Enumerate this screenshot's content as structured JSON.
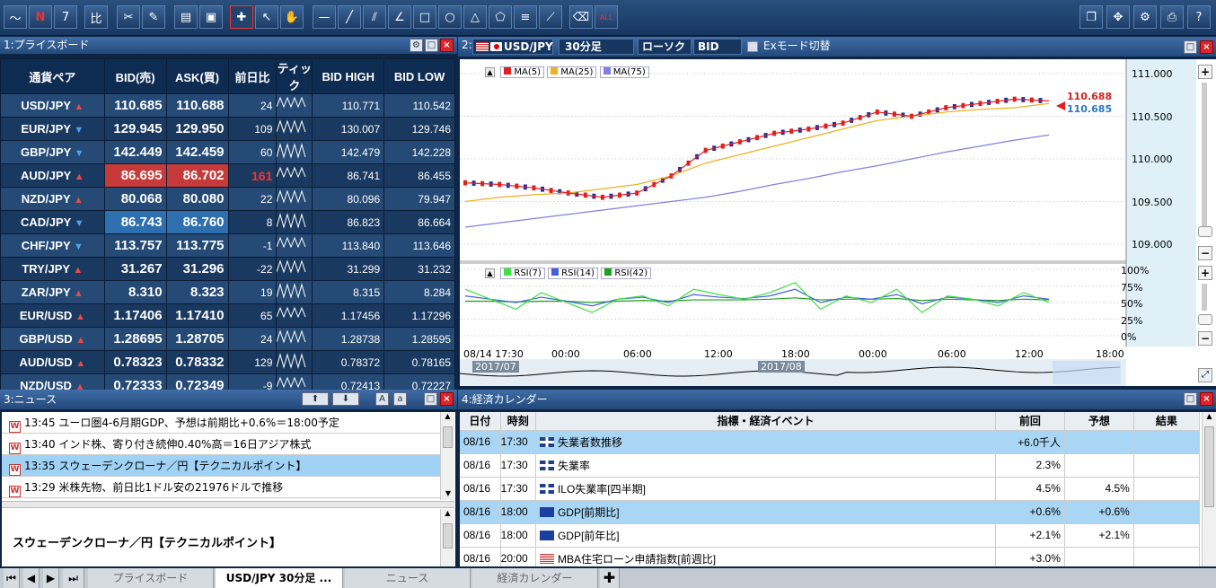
{
  "panels": {
    "priceboard": "1:プライスボード",
    "chart": "2:",
    "news": "3:ニュース",
    "calendar": "4:経済カレンダー"
  },
  "chart_toolbar": {
    "pair": "USD/JPY",
    "interval": "30分足",
    "type": "ローソク",
    "side": "BID",
    "ex_mode": "Exモード切替"
  },
  "priceboard": {
    "headers": [
      "通貨ペア",
      "BID(売)",
      "ASK(買)",
      "前日比",
      "ティック",
      "BID HIGH",
      "BID LOW"
    ],
    "rows": [
      {
        "pair": "USD/JPY",
        "dir": "up",
        "bid": "110.685",
        "ask": "110.688",
        "chg": "24",
        "high": "110.771",
        "low": "110.542"
      },
      {
        "pair": "EUR/JPY",
        "dir": "down",
        "bid": "129.945",
        "ask": "129.950",
        "chg": "109",
        "high": "130.007",
        "low": "129.746"
      },
      {
        "pair": "GBP/JPY",
        "dir": "down",
        "bid": "142.449",
        "ask": "142.459",
        "chg": "60",
        "high": "142.479",
        "low": "142.228"
      },
      {
        "pair": "AUD/JPY",
        "dir": "up",
        "bid": "86.695",
        "ask": "86.702",
        "chg": "161",
        "high": "86.741",
        "low": "86.455"
      },
      {
        "pair": "NZD/JPY",
        "dir": "up",
        "bid": "80.068",
        "ask": "80.080",
        "chg": "22",
        "high": "80.096",
        "low": "79.947"
      },
      {
        "pair": "CAD/JPY",
        "dir": "down",
        "bid": "86.743",
        "ask": "86.760",
        "chg": "8",
        "high": "86.823",
        "low": "86.664"
      },
      {
        "pair": "CHF/JPY",
        "dir": "down",
        "bid": "113.757",
        "ask": "113.775",
        "chg": "-1",
        "high": "113.840",
        "low": "113.646"
      },
      {
        "pair": "TRY/JPY",
        "dir": "up",
        "bid": "31.267",
        "ask": "31.296",
        "chg": "-22",
        "high": "31.299",
        "low": "31.232"
      },
      {
        "pair": "ZAR/JPY",
        "dir": "up",
        "bid": "8.310",
        "ask": "8.323",
        "chg": "19",
        "high": "8.315",
        "low": "8.284"
      },
      {
        "pair": "EUR/USD",
        "dir": "up",
        "bid": "1.17406",
        "ask": "1.17410",
        "chg": "65",
        "high": "1.17456",
        "low": "1.17296"
      },
      {
        "pair": "GBP/USD",
        "dir": "up",
        "bid": "1.28695",
        "ask": "1.28705",
        "chg": "24",
        "high": "1.28738",
        "low": "1.28595"
      },
      {
        "pair": "AUD/USD",
        "dir": "up",
        "bid": "0.78323",
        "ask": "0.78332",
        "chg": "129",
        "high": "0.78372",
        "low": "0.78165"
      },
      {
        "pair": "NZD/USD",
        "dir": "up",
        "bid": "0.72333",
        "ask": "0.72349",
        "chg": "-9",
        "high": "0.72413",
        "low": "0.72227"
      }
    ]
  },
  "chart": {
    "legend_ma": [
      "MA(5)",
      "MA(25)",
      "MA(75)"
    ],
    "legend_rsi": [
      "RSI(7)",
      "RSI(14)",
      "RSI(42)"
    ],
    "price_ticks": [
      "111.000",
      "110.500",
      "110.000",
      "109.500",
      "109.000"
    ],
    "rsi_ticks": [
      "100%",
      "75%",
      "50%",
      "25%",
      "0%"
    ],
    "ask_label": "110.688",
    "bid_label": "110.685",
    "time_ticks": [
      "08/14 17:30",
      "00:00",
      "06:00",
      "12:00",
      "18:00",
      "00:00",
      "06:00",
      "12:00",
      "18:00"
    ],
    "overview_labels": [
      "2017/07",
      "2017/08"
    ],
    "colors": {
      "ma5": "#e02020",
      "ma25": "#f0b020",
      "ma75": "#8080e0",
      "rsi7": "#40e040",
      "rsi14": "#4060e0",
      "rsi42": "#20a020"
    }
  },
  "chart_data": {
    "type": "line",
    "title": "",
    "ylim": [
      109.0,
      111.0
    ],
    "series": [
      {
        "name": "MA(5)",
        "values": [
          109.72,
          109.7,
          109.66,
          109.6,
          109.55,
          109.6,
          109.8,
          110.1,
          110.2,
          110.3,
          110.35,
          110.42,
          110.55,
          110.5,
          110.6,
          110.65,
          110.7,
          110.68
        ]
      },
      {
        "name": "MA(25)",
        "values": [
          109.5,
          109.55,
          109.58,
          109.6,
          109.65,
          109.7,
          109.8,
          109.95,
          110.05,
          110.15,
          110.25,
          110.35,
          110.45,
          110.5,
          110.55,
          110.58,
          110.6,
          110.65
        ]
      },
      {
        "name": "MA(75)",
        "values": [
          109.2,
          109.25,
          109.3,
          109.35,
          109.4,
          109.45,
          109.5,
          109.55,
          109.62,
          109.7,
          109.77,
          109.85,
          109.92,
          110.0,
          110.08,
          110.15,
          110.22,
          110.28
        ]
      }
    ]
  },
  "news": {
    "items": [
      {
        "time": "13:45",
        "text": "ユーロ圏4-6月期GDP、予想は前期比+0.6%＝18:00予定"
      },
      {
        "time": "13:40",
        "text": "インド株、寄り付き続伸0.40%高＝16日アジア株式"
      },
      {
        "time": "13:35",
        "text": "スウェーデンクローナ／円【テクニカルポイント】"
      },
      {
        "time": "13:29",
        "text": "米株先物、前日比1ドル安の21976ドルで推移"
      }
    ],
    "detail_title": "スウェーデンクローナ／円【テクニカルポイント】"
  },
  "calendar": {
    "headers": [
      "日付",
      "時刻",
      "指標・経済イベント",
      "前回",
      "予想",
      "結果"
    ],
    "rows": [
      {
        "date": "08/16",
        "time": "17:30",
        "flag": "uk",
        "event": "失業者数推移",
        "prev": "+6.0千人",
        "fcst": "",
        "result": ""
      },
      {
        "date": "08/16",
        "time": "17:30",
        "flag": "uk",
        "event": "失業率",
        "prev": "2.3%",
        "fcst": "",
        "result": ""
      },
      {
        "date": "08/16",
        "time": "17:30",
        "flag": "uk",
        "event": "ILO失業率[四半期]",
        "prev": "4.5%",
        "fcst": "4.5%",
        "result": ""
      },
      {
        "date": "08/16",
        "time": "18:00",
        "flag": "eu",
        "event": "GDP[前期比]",
        "prev": "+0.6%",
        "fcst": "+0.6%",
        "result": ""
      },
      {
        "date": "08/16",
        "time": "18:00",
        "flag": "eu",
        "event": "GDP[前年比]",
        "prev": "+2.1%",
        "fcst": "+2.1%",
        "result": ""
      },
      {
        "date": "08/16",
        "time": "20:00",
        "flag": "us",
        "event": "MBA住宅ローン申請指数[前週比]",
        "prev": "+3.0%",
        "fcst": "",
        "result": ""
      }
    ]
  },
  "tabs": [
    "プライスボード",
    "USD/JPY 30分足 ...",
    "ニュース",
    "経済カレンダー"
  ]
}
